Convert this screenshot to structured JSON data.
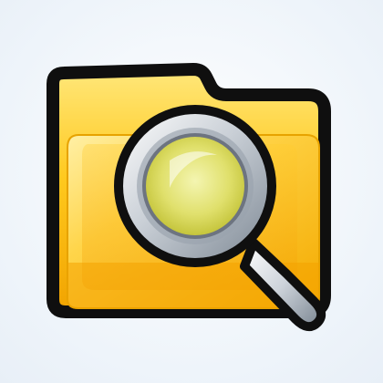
{
  "icon": {
    "name": "folder-search-icon",
    "parts": [
      "folder-icon",
      "magnifying-glass-icon"
    ],
    "colors": {
      "background": "#f3f7fb",
      "folder_outline": "#111111",
      "folder_back": "#f4b800",
      "folder_front_light": "#ffe070",
      "folder_front_dark": "#f3a900",
      "lens_glass": "#e3e36a",
      "lens_rim": "#b9bfc6",
      "handle": "#c8ced5"
    }
  }
}
